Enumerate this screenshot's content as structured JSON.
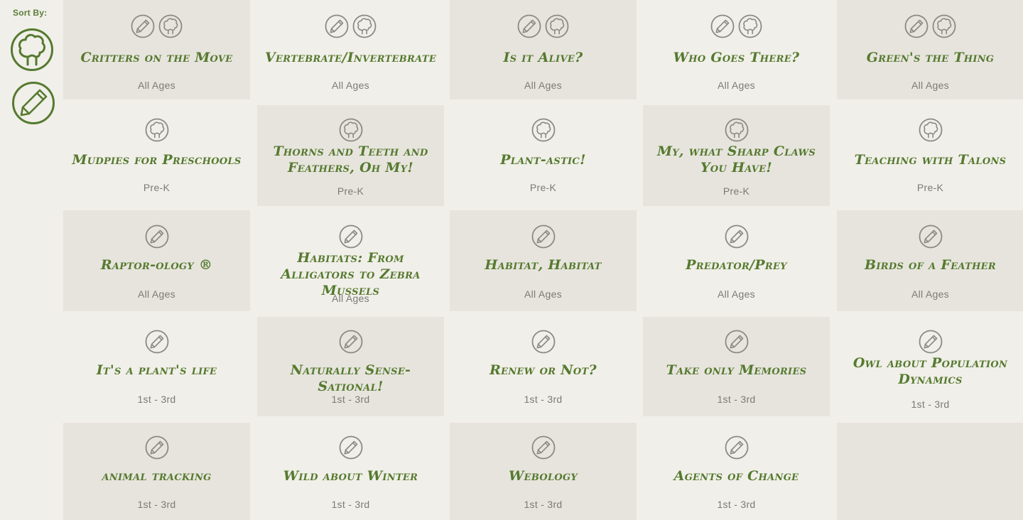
{
  "sort": {
    "label": "Sort By:",
    "options": [
      {
        "icon": "tree-icon",
        "name": "sort-by-tree"
      },
      {
        "icon": "pencil-icon",
        "name": "sort-by-pencil"
      }
    ]
  },
  "colors": {
    "accent": "#557a2f",
    "icon_gray": "#8a8a86",
    "page_bg": "#f1efe9",
    "card_shade": "#e7e4dd",
    "age_text": "#7a7a76"
  },
  "programs": [
    {
      "title": "Critters on the Move",
      "age": "All Ages",
      "icons": [
        "pencil-icon",
        "tree-icon"
      ]
    },
    {
      "title": "Vertebrate/Invertebrate",
      "age": "All Ages",
      "icons": [
        "pencil-icon",
        "tree-icon"
      ]
    },
    {
      "title": "Is it Alive?",
      "age": "All Ages",
      "icons": [
        "pencil-icon",
        "tree-icon"
      ]
    },
    {
      "title": "Who Goes There?",
      "age": "All Ages",
      "icons": [
        "pencil-icon",
        "tree-icon"
      ]
    },
    {
      "title": "Green's the Thing",
      "age": "All Ages",
      "icons": [
        "pencil-icon",
        "tree-icon"
      ]
    },
    {
      "title": "Mudpies for Preschools",
      "age": "Pre-K",
      "icons": [
        "tree-icon"
      ]
    },
    {
      "title": "Thorns and Teeth and Feathers, Oh My!",
      "age": "Pre-K",
      "icons": [
        "tree-icon"
      ]
    },
    {
      "title": "Plant-astic!",
      "age": "Pre-K",
      "icons": [
        "tree-icon"
      ]
    },
    {
      "title": "My, what Sharp Claws You Have!",
      "age": "Pre-K",
      "icons": [
        "tree-icon"
      ]
    },
    {
      "title": "Teaching with Talons",
      "age": "Pre-K",
      "icons": [
        "tree-icon"
      ]
    },
    {
      "title": "Raptor-ology ®",
      "age": "All Ages",
      "icons": [
        "pencil-icon"
      ]
    },
    {
      "title": "Habitats: From Alligators to Zebra Mussels",
      "age": "All Ages",
      "icons": [
        "pencil-icon"
      ]
    },
    {
      "title": "Habitat, Habitat",
      "age": "All Ages",
      "icons": [
        "pencil-icon"
      ]
    },
    {
      "title": "Predator/Prey",
      "age": "All Ages",
      "icons": [
        "pencil-icon"
      ]
    },
    {
      "title": "Birds of a Feather",
      "age": "All Ages",
      "icons": [
        "pencil-icon"
      ]
    },
    {
      "title": "It's a plant's life",
      "age": "1st - 3rd",
      "icons": [
        "pencil-icon"
      ]
    },
    {
      "title": "Naturally Sense-Sational!",
      "age": "1st - 3rd",
      "icons": [
        "pencil-icon"
      ]
    },
    {
      "title": "Renew or Not?",
      "age": "1st - 3rd",
      "icons": [
        "pencil-icon"
      ]
    },
    {
      "title": "Take only Memories",
      "age": "1st - 3rd",
      "icons": [
        "pencil-icon"
      ]
    },
    {
      "title": "Owl about Population Dynamics",
      "age": "1st - 3rd",
      "icons": [
        "pencil-icon"
      ]
    },
    {
      "title": "animal tracking",
      "age": "1st - 3rd",
      "icons": [
        "pencil-icon"
      ]
    },
    {
      "title": "Wild about Winter",
      "age": "1st - 3rd",
      "icons": [
        "pencil-icon"
      ]
    },
    {
      "title": "Webology",
      "age": "1st - 3rd",
      "icons": [
        "pencil-icon"
      ]
    },
    {
      "title": "Agents of Change",
      "age": "1st - 3rd",
      "icons": [
        "pencil-icon"
      ]
    }
  ]
}
